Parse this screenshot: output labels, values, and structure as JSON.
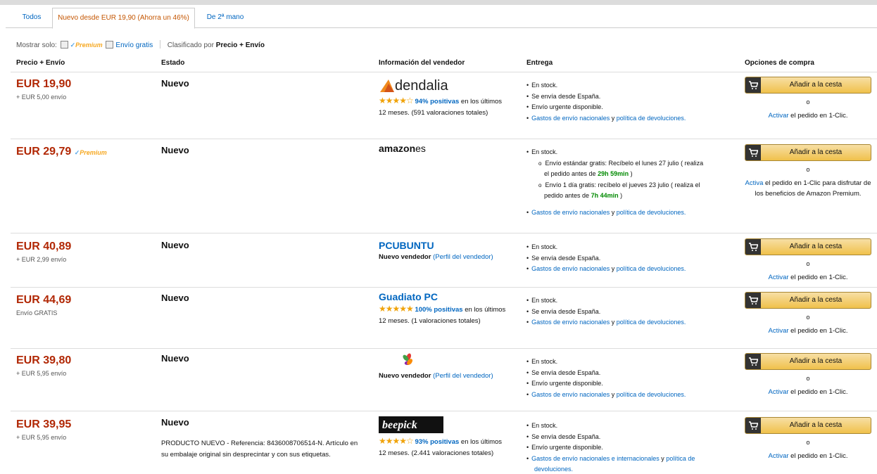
{
  "tabs": [
    {
      "label": "Todos"
    },
    {
      "label": "Nuevo desde EUR 19,90 (Ahorra un 46%)"
    },
    {
      "label": "De 2ª mano"
    }
  ],
  "filter": {
    "show_only": "Mostrar solo:",
    "premium": "Premium",
    "free_shipping": "Envío gratis",
    "sorted_by": "Clasificado por",
    "sort_value": "Precio + Envío"
  },
  "columns": {
    "price": "Precio + Envío",
    "condition": "Estado",
    "seller": "Información del vendedor",
    "delivery": "Entrega",
    "options": "Opciones de compra"
  },
  "common": {
    "add_to_cart": "Añadir a la cesta",
    "or": "o",
    "activate": "Activar",
    "activa": "Activa",
    "oneclick_rest": "el pedido en 1-Clic.",
    "oneclick_premium_rest": "el pedido en 1-Clic para disfrutar de los beneficios de Amazon Premium.",
    "in_stock": "En stock.",
    "ships_from": "Se envía desde España.",
    "urgent": "Envío urgente disponible.",
    "shipping_costs": "Gastos de envío nacionales",
    "shipping_costs_intl": "Gastos de envío nacionales e internacionales",
    "and": "y",
    "returns": "política de devoluciones.",
    "new_seller": "Nuevo vendedor",
    "seller_profile": "(Perfil del vendedor)"
  },
  "offers": [
    {
      "price": "EUR 19,90",
      "shipping": "+ EUR 5,00 envío",
      "condition": "Nuevo",
      "seller_logo": "dendalia",
      "stars": "★★★★☆",
      "positive": "94% positivas",
      "rating_text_a": "en los",
      "rating_text_b": "últimos 12 meses. (591 valoraciones",
      "rating_text_c": "totales)"
    },
    {
      "price": "EUR 29,79",
      "premium_badge": "Premium",
      "condition": "Nuevo",
      "seller_logo_a": "amazon",
      "seller_logo_b": "es",
      "std_a": "Envío estándar gratis: Recíbelo el lunes 27 julio ( realiza",
      "std_b": "el pedido antes de",
      "std_time": "29h 59min",
      "std_c": ")",
      "one_a": "Envío 1 día gratis: recíbelo el jueves 23 julio ( realiza el",
      "one_b": "pedido antes de",
      "one_time": "7h 44min",
      "one_c": ")"
    },
    {
      "price": "EUR 40,89",
      "shipping": "+ EUR 2,99 envío",
      "condition": "Nuevo",
      "seller_name": "PCUBUNTU"
    },
    {
      "price": "EUR 44,69",
      "shipping": "Envío GRATIS",
      "condition": "Nuevo",
      "seller_name": "Guadiato PC",
      "stars": "★★★★★",
      "positive": "100% positivas",
      "rating_text_a": "en los",
      "rating_text_b": "últimos 12 meses. (1 valoraciones",
      "rating_text_c": "totales)"
    },
    {
      "price": "EUR 39,80",
      "shipping": "+ EUR 5,95 envío",
      "condition": "Nuevo"
    },
    {
      "price": "EUR 39,95",
      "shipping": "+ EUR 5,95 envío",
      "condition": "Nuevo",
      "comment": "PRODUCTO NUEVO - Referencia: 8436008706514-N. Artículo en su embalaje original sin desprecintar y con sus etiquetas.",
      "seller_logo": "beepick",
      "stars": "★★★★☆",
      "positive": "93% positivas",
      "rating_text_a": "en los",
      "rating_text_b": "últimos 12 meses. (2.441 valoraciones",
      "rating_text_c": "totales)",
      "shipping_tail": "devoluciones."
    }
  ]
}
